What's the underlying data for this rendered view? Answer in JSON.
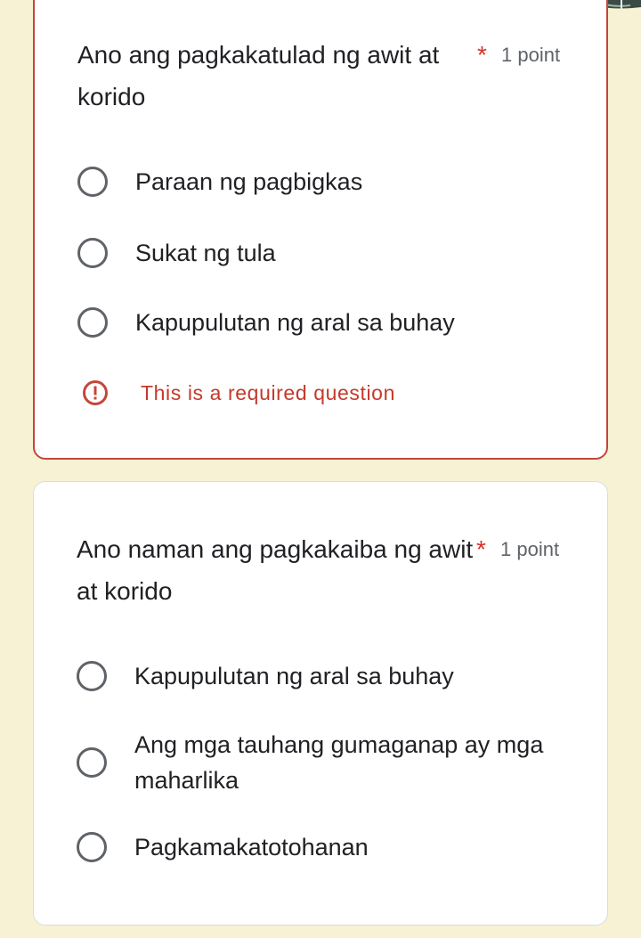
{
  "colors": {
    "page_background": "#f6f2d3",
    "card_background": "#ffffff",
    "error_accent": "#c4473a",
    "required_star": "#d93025",
    "radio_outline": "#5f6368",
    "text_primary": "#202124",
    "text_secondary": "#5f6368"
  },
  "questions": [
    {
      "title": "Ano ang pagkakatulad ng awit at korido",
      "required_marker": "*",
      "points": "1 point",
      "options": [
        {
          "label": "Paraan ng pagbigkas",
          "selected": false
        },
        {
          "label": "Sukat ng tula",
          "selected": false
        },
        {
          "label": "Kapupulutan ng aral sa buhay",
          "selected": false
        }
      ],
      "error": {
        "icon": "error-exclamation-icon",
        "message": "This is a required question"
      }
    },
    {
      "title": "Ano naman ang pagkakaiba ng awit at korido",
      "required_marker": "*",
      "points": "1 point",
      "options": [
        {
          "label": "Kapupulutan ng aral sa buhay",
          "selected": false
        },
        {
          "label": "Ang mga tauhang gumaganap ay mga maharlika",
          "selected": false
        },
        {
          "label": "Pagkamakatotohanan",
          "selected": false
        }
      ]
    }
  ]
}
